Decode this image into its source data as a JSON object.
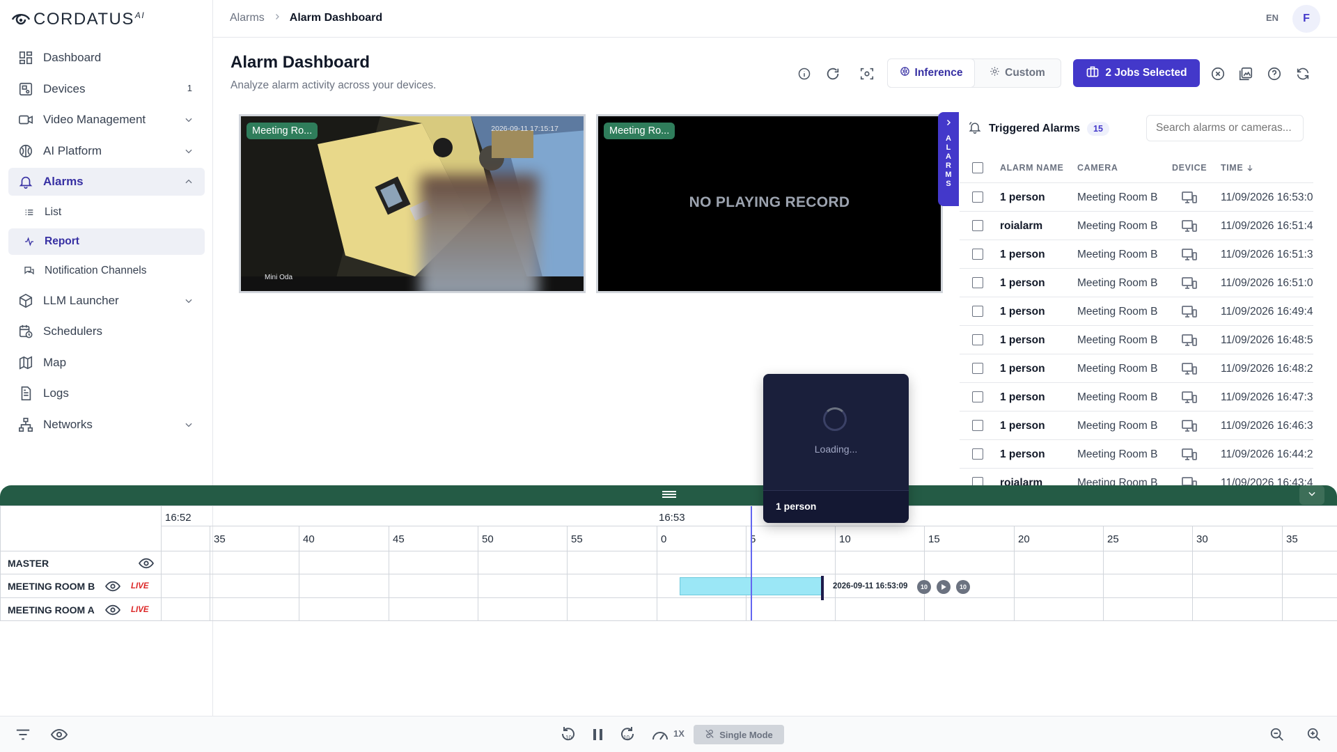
{
  "app": {
    "logo_text": "CORDATUS",
    "logo_sup": "AI"
  },
  "sidebar": {
    "items": [
      {
        "label": "Dashboard",
        "icon": "dashboard-icon"
      },
      {
        "label": "Devices",
        "icon": "devices-icon",
        "badge": "1"
      },
      {
        "label": "Video Management",
        "icon": "video-icon"
      },
      {
        "label": "AI Platform",
        "icon": "brain-icon"
      },
      {
        "label": "Alarms",
        "icon": "bell-icon"
      },
      {
        "label": "List",
        "icon": "list-icon"
      },
      {
        "label": "Report",
        "icon": "activity-icon"
      },
      {
        "label": "Notification Channels",
        "icon": "chat-icon"
      },
      {
        "label": "LLM Launcher",
        "icon": "cube-icon"
      },
      {
        "label": "Schedulers",
        "icon": "calendar-clock-icon"
      },
      {
        "label": "Map",
        "icon": "map-icon"
      },
      {
        "label": "Logs",
        "icon": "file-icon"
      },
      {
        "label": "Networks",
        "icon": "network-icon"
      }
    ]
  },
  "header": {
    "breadcrumb_root": "Alarms",
    "breadcrumb_current": "Alarm Dashboard",
    "language": "EN",
    "avatar_initial": "F"
  },
  "page": {
    "title": "Alarm Dashboard",
    "subtitle": "Analyze alarm activity across your devices."
  },
  "toolbar": {
    "inference_label": "Inference",
    "custom_label": "Custom",
    "jobs_label": "2 Jobs Selected"
  },
  "tiles": [
    {
      "label": "Meeting Ro...",
      "timestamp": "2026-09-11 17:15:17",
      "camera_caption": "Mini Oda"
    },
    {
      "label": "Meeting Ro...",
      "message": "NO PLAYING RECORD"
    }
  ],
  "alarm_tab": {
    "letters": [
      "A",
      "L",
      "A",
      "R",
      "M",
      "S"
    ]
  },
  "panel": {
    "title": "Triggered Alarms",
    "count": "15",
    "search_placeholder": "Search alarms or cameras...",
    "columns": {
      "name": "ALARM NAME",
      "camera": "CAMERA",
      "device": "DEVICE",
      "time": "TIME"
    },
    "rows": [
      {
        "name": "1 person",
        "camera": "Meeting Room B",
        "time": "11/09/2026 16:53:0"
      },
      {
        "name": "roialarm",
        "camera": "Meeting Room B",
        "time": "11/09/2026 16:51:4"
      },
      {
        "name": "1 person",
        "camera": "Meeting Room B",
        "time": "11/09/2026 16:51:3"
      },
      {
        "name": "1 person",
        "camera": "Meeting Room B",
        "time": "11/09/2026 16:51:0"
      },
      {
        "name": "1 person",
        "camera": "Meeting Room B",
        "time": "11/09/2026 16:49:4"
      },
      {
        "name": "1 person",
        "camera": "Meeting Room B",
        "time": "11/09/2026 16:48:5"
      },
      {
        "name": "1 person",
        "camera": "Meeting Room B",
        "time": "11/09/2026 16:48:2"
      },
      {
        "name": "1 person",
        "camera": "Meeting Room B",
        "time": "11/09/2026 16:47:3"
      },
      {
        "name": "1 person",
        "camera": "Meeting Room B",
        "time": "11/09/2026 16:46:3"
      },
      {
        "name": "1 person",
        "camera": "Meeting Room B",
        "time": "11/09/2026 16:44:2"
      },
      {
        "name": "roialarm",
        "camera": "Meeting Room B",
        "time": "11/09/2026 16:43:4"
      }
    ]
  },
  "loading": {
    "text": "Loading...",
    "footer": "1 person"
  },
  "timeline": {
    "major_labels": [
      "16:52",
      "16:53"
    ],
    "ticks": [
      "35",
      "40",
      "45",
      "50",
      "55",
      "0",
      "5",
      "10",
      "15",
      "20",
      "25",
      "30",
      "35"
    ],
    "tracks": [
      {
        "label": "MASTER",
        "live": ""
      },
      {
        "label": "MEETING ROOM B",
        "live": "LIVE"
      },
      {
        "label": "MEETING ROOM A",
        "live": "LIVE"
      }
    ],
    "clip_timestamp": "2026-09-11 16:53:09",
    "skip_seconds": "10"
  },
  "playback": {
    "speed": "1X",
    "mode_label": "Single Mode"
  },
  "colors": {
    "accent": "#4338ca",
    "timeline_bar": "#245b45",
    "live": "#dc2626",
    "clip": "#9be7f6",
    "label_bg": "#2f7d5b"
  }
}
